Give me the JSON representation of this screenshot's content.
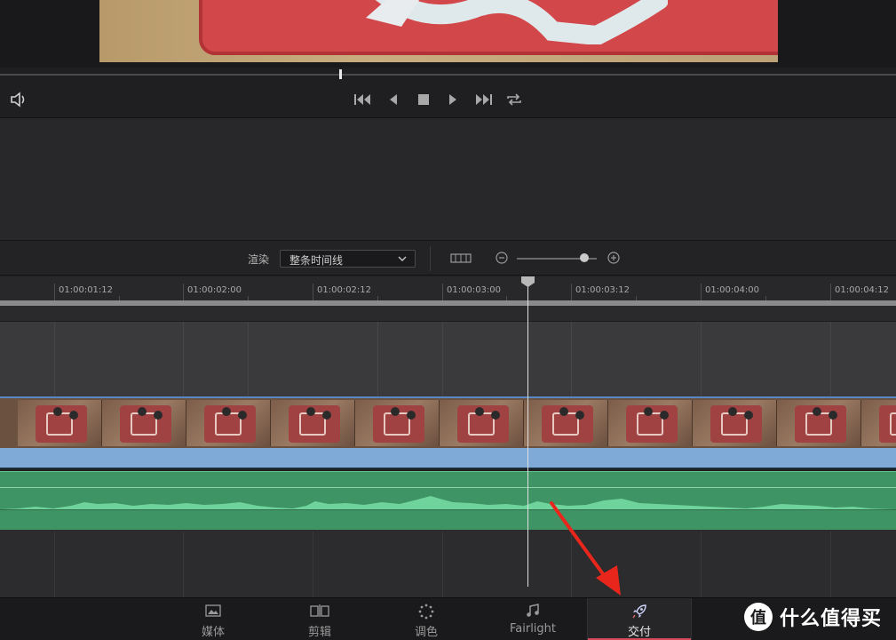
{
  "viewer": {
    "transport": {
      "icons": [
        "skip-to-start-icon",
        "step-back-icon",
        "stop-icon",
        "play-icon",
        "skip-to-end-icon",
        "loop-icon"
      ]
    },
    "volume_icon": "speaker-icon"
  },
  "render_bar": {
    "label": "渲染",
    "select_value": "整条时间线"
  },
  "timeline": {
    "timecodes": [
      "01:00:01:12",
      "01:00:02:00",
      "01:00:02:12",
      "01:00:03:00",
      "01:00:03:12",
      "01:00:04:00",
      "01:00:04:12"
    ]
  },
  "page_tabs": [
    {
      "label": "媒体",
      "icon": "media-icon",
      "active": false
    },
    {
      "label": "剪辑",
      "icon": "edit-icon",
      "active": false
    },
    {
      "label": "调色",
      "icon": "color-icon",
      "active": false
    },
    {
      "label": "Fairlight",
      "icon": "music-note-icon",
      "active": false
    },
    {
      "label": "交付",
      "icon": "rocket-icon",
      "active": true
    }
  ],
  "watermark": {
    "logo_text": "值",
    "text": "什么值得买"
  },
  "colors": {
    "accent": "#d6485a",
    "audio": "#3f9466",
    "video_selection": "#7fa9d6",
    "arrow": "#e8261c"
  }
}
